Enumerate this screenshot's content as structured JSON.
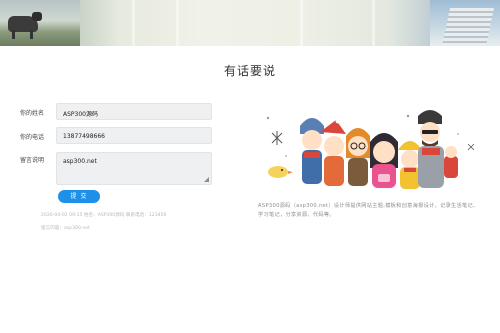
{
  "page": {
    "title": "有话要说"
  },
  "form": {
    "name_label": "你的姓名",
    "name_value": "ASP300源码",
    "phone_label": "你的电话",
    "phone_value": "13877498666",
    "message_label": "留言说明",
    "message_value": "asp300.net",
    "submit_label": "提 交"
  },
  "record": {
    "info": "2020-04-02 09:15 姓名：ASP300源码 联系电话：123456",
    "content": "留言内容：asp300.net"
  },
  "aside": {
    "description": "ASP300源码（asp300.net）设计师提供网站主题,模板和创意海报设计，记录生活笔记、学习笔记，分享资源、代码等。"
  },
  "colors": {
    "accent": "#1e90e8",
    "field_bg": "#eef0f2",
    "muted_text": "#b4b8bc"
  },
  "icons": {
    "resize": "resize-grip-icon",
    "snowflake": "snowflake-icon"
  }
}
